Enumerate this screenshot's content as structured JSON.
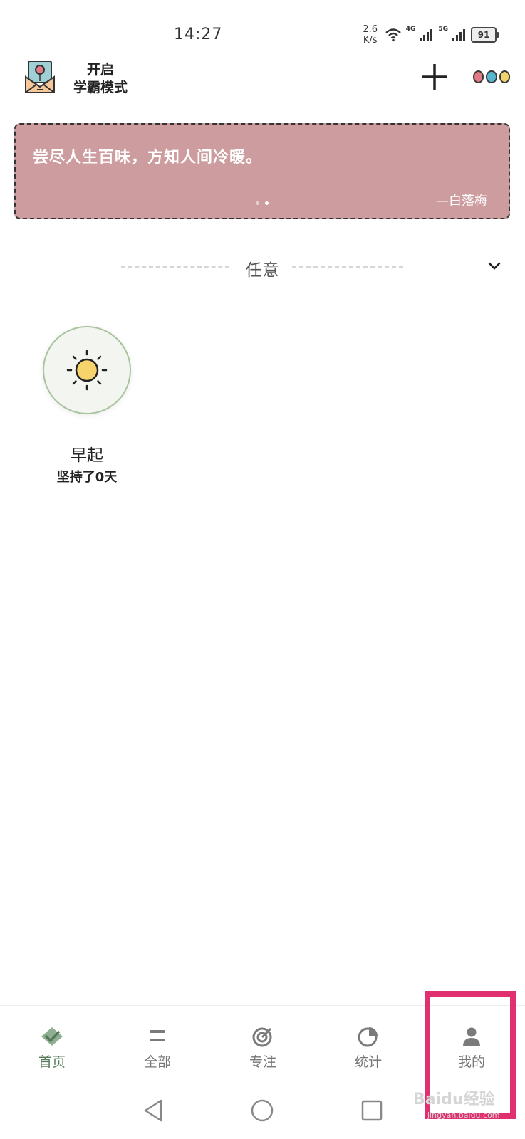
{
  "status_bar": {
    "time": "14:27",
    "net_speed_value": "2.6",
    "net_speed_unit": "K/s",
    "sim1_label": "4G",
    "sim2_label": "5G",
    "battery": "91"
  },
  "header": {
    "mode_line1": "开启",
    "mode_line2": "学霸模式",
    "icons": [
      "envelope-balloon-icon",
      "plus-icon",
      "three-dots-icon"
    ],
    "dot_colors": [
      "#e07a86",
      "#57b6cf",
      "#f2d36b"
    ]
  },
  "quote": {
    "text": "尝尽人生百味，方知人间冷暖。",
    "author": "—白落梅",
    "background": "#cc9c9f",
    "page_count": 2,
    "active_page": 2
  },
  "filter": {
    "label": "任意"
  },
  "habits": [
    {
      "name": "早起",
      "streak": "坚持了0天",
      "icon": "sun-icon"
    }
  ],
  "tabs": [
    {
      "label": "首页",
      "icon": "home-check-icon",
      "active": true
    },
    {
      "label": "全部",
      "icon": "list-icon",
      "active": false
    },
    {
      "label": "专注",
      "icon": "target-icon",
      "active": false
    },
    {
      "label": "统计",
      "icon": "pie-chart-icon",
      "active": false
    },
    {
      "label": "我的",
      "icon": "person-icon",
      "active": false
    }
  ],
  "accent_color": "#557a59",
  "highlight_color": "#e0306f",
  "watermark": {
    "main": "Baidu经验",
    "sub": "jingyan.baidu.com"
  }
}
